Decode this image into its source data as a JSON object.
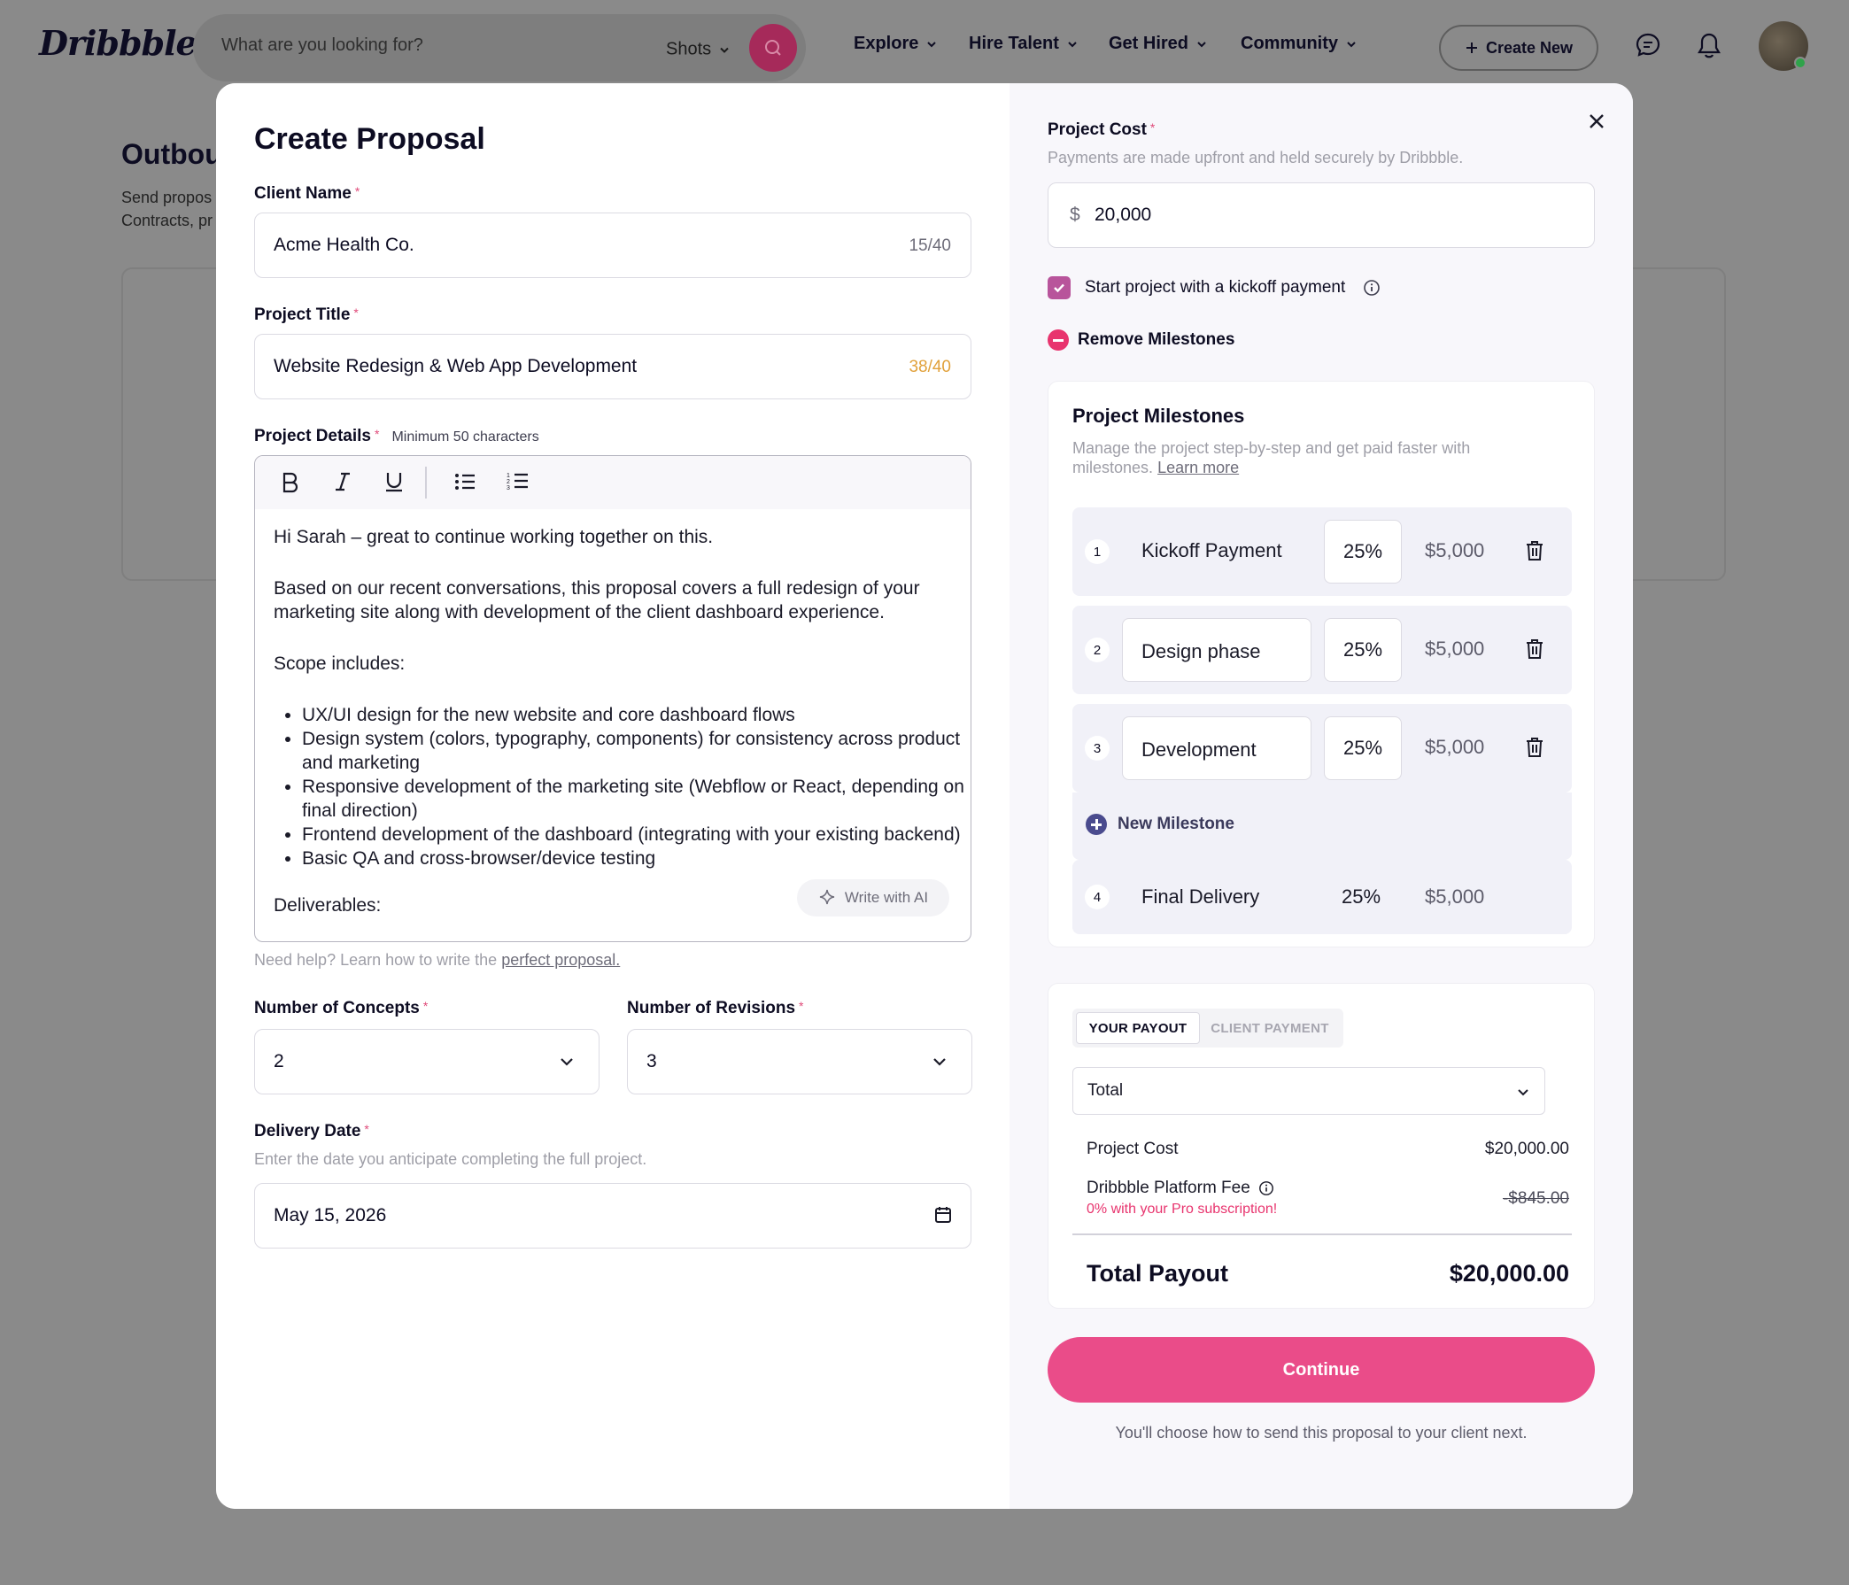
{
  "nav": {
    "logo": "Dribbble",
    "search_placeholder": "What are you looking for?",
    "search_scope": "Shots",
    "links": [
      "Explore",
      "Hire Talent",
      "Get Hired",
      "Community"
    ],
    "create_new": "Create New"
  },
  "background": {
    "title": "Outbou",
    "subtitle_line1": "Send propos",
    "subtitle_line2": "Contracts, pr"
  },
  "modal": {
    "title": "Create Proposal",
    "client_name": {
      "label": "Client Name",
      "value": "Acme Health Co.",
      "counter": "15/40"
    },
    "project_title": {
      "label": "Project Title",
      "value": "Website Redesign & Web App Development",
      "counter": "38/40"
    },
    "project_details": {
      "label": "Project Details",
      "hint": "Minimum 50 characters",
      "paragraphs": [
        "Hi Sarah – great to continue working together on this.",
        "Based on our recent conversations, this proposal covers a full redesign of your marketing site along with development of the client dashboard experience.",
        "Scope includes:"
      ],
      "bullets": [
        "UX/UI design for the new website and core dashboard flows",
        "Design system (colors, typography, components) for consistency across product and marketing",
        "Responsive development of the marketing site (Webflow or React, depending on final direction)",
        "Frontend development of the dashboard (integrating with your existing backend)",
        "Basic QA and cross-browser/device testing"
      ],
      "trailing": "Deliverables:",
      "write_ai": "Write with AI"
    },
    "help": {
      "prefix": "Need help? Learn how to write the ",
      "link": "perfect proposal."
    },
    "concepts": {
      "label": "Number of Concepts",
      "value": "2"
    },
    "revisions": {
      "label": "Number of Revisions",
      "value": "3"
    },
    "delivery": {
      "label": "Delivery Date",
      "sub": "Enter the date you anticipate completing the full project.",
      "value": "May 15, 2026"
    },
    "project_cost": {
      "label": "Project Cost",
      "sub": "Payments are made upfront and held securely by Dribbble.",
      "currency": "$",
      "value": "20,000"
    },
    "kickoff_label": "Start project with a kickoff payment",
    "kickoff_checked": true,
    "remove_milestones": "Remove Milestones",
    "milestones": {
      "title": "Project Milestones",
      "desc": "Manage the project step-by-step and get paid faster with milestones.",
      "learn_more": "Learn more",
      "items": [
        {
          "num": "1",
          "name": "Kickoff Payment",
          "pct": "25%",
          "amount": "$5,000"
        },
        {
          "num": "2",
          "name": "Design phase",
          "pct": "25%",
          "amount": "$5,000"
        },
        {
          "num": "3",
          "name": "Development",
          "pct": "25%",
          "amount": "$5,000"
        },
        {
          "num": "4",
          "name": "Final Delivery",
          "pct": "25%",
          "amount": "$5,000"
        }
      ],
      "new_label": "New Milestone"
    },
    "payout": {
      "tab_active": "YOUR PAYOUT",
      "tab_inactive": "CLIENT PAYMENT",
      "select": "Total",
      "project_cost_label": "Project Cost",
      "project_cost_value": "$20,000.00",
      "fee_label": "Dribbble Platform Fee",
      "fee_note": "0% with your Pro subscription!",
      "fee_value": "-$845.00",
      "total_label": "Total Payout",
      "total_value": "$20,000.00"
    },
    "continue": "Continue",
    "footnote": "You'll choose how to send this proposal to your client next."
  },
  "colors": {
    "brand_pink": "#ea4c89",
    "check_purple": "#b8549b",
    "warn_counter": "#e1a13b",
    "overlay": "#8a8a8a"
  }
}
